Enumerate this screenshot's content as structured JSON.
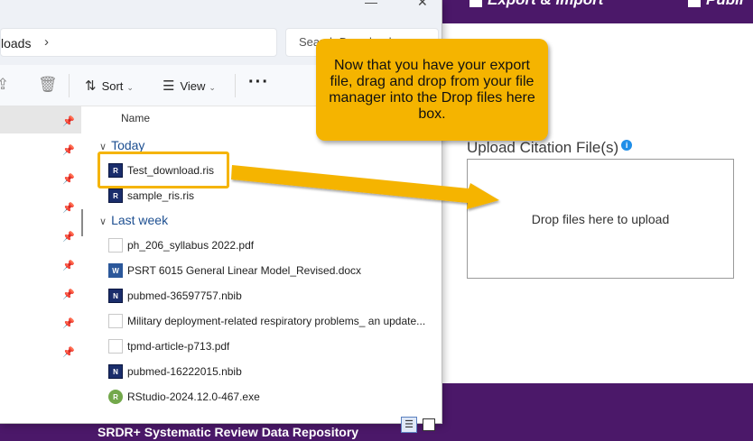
{
  "webapp": {
    "nav": {
      "export_import_label": "Export & Import",
      "publication_label": "Publi"
    },
    "upload": {
      "title": "Upload Citation File(s)",
      "info_icon": "i",
      "dropzone_label": "Drop files here to upload"
    },
    "footer": {
      "text": "SRDR+ Systematic Review Data Repository"
    },
    "colors": {
      "brand_purple": "#4b1869"
    }
  },
  "explorer": {
    "address": {
      "path_fragment": "loads",
      "chevron": "›"
    },
    "search": {
      "placeholder": "Search Downloads",
      "icon": "search-icon"
    },
    "toolbar": {
      "sort_label": "Sort",
      "view_label": "View",
      "more_label": "···"
    },
    "columns": {
      "name": "Name"
    },
    "groups": [
      {
        "label": "Today",
        "files": [
          {
            "name": "Test_download.ris",
            "type": "ris"
          },
          {
            "name": "sample_ris.ris",
            "type": "ris"
          }
        ]
      },
      {
        "label": "Last week",
        "files": [
          {
            "name": "ph_206_syllabus 2022.pdf",
            "type": "pdf"
          },
          {
            "name": "PSRT 6015 General Linear Model_Revised.docx",
            "type": "docx"
          },
          {
            "name": "pubmed-36597757.nbib",
            "type": "nbib"
          },
          {
            "name": "Military deployment-related respiratory problems_ an update...",
            "type": "pdf"
          },
          {
            "name": "tpmd-article-p713.pdf",
            "type": "pdf"
          },
          {
            "name": "pubmed-16222015.nbib",
            "type": "nbib"
          },
          {
            "name": "RStudio-2024.12.0-467.exe",
            "type": "exe"
          }
        ]
      }
    ]
  },
  "annotation": {
    "callout_text": "Now that you have your export file, drag and drop from your file manager into the Drop files here box.",
    "highlight_color": "#f5b400"
  }
}
